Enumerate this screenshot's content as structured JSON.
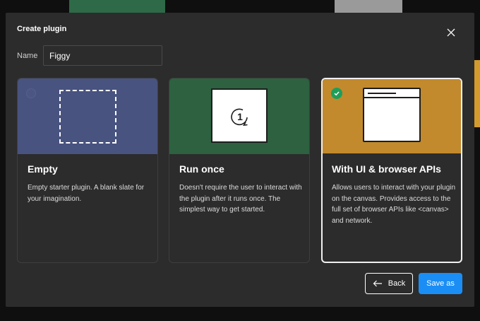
{
  "dialog": {
    "title": "Create plugin",
    "close_icon": "close-icon",
    "name_label": "Name",
    "name_value": "Figgy"
  },
  "cards": [
    {
      "title": "Empty",
      "description": "Empty starter plugin. A blank slate for your imagination.",
      "color": "#485380",
      "icon": "dashed-square-icon",
      "selected": false
    },
    {
      "title": "Run once",
      "description": "Doesn't require the user to interact with the plugin after it runs once. The simplest way to get started.",
      "color": "#2d6140",
      "icon": "run-once-icon",
      "selected": false
    },
    {
      "title": "With UI & browser APIs",
      "description": "Allows users to interact with your plugin on the canvas. Provides access to the full set of browser APIs like <canvas> and network.",
      "color": "#c28a2c",
      "icon": "browser-window-icon",
      "selected": true
    }
  ],
  "footer": {
    "back_label": "Back",
    "back_icon": "arrow-left-icon",
    "save_label": "Save as",
    "save_color": "#1a8ef5"
  }
}
